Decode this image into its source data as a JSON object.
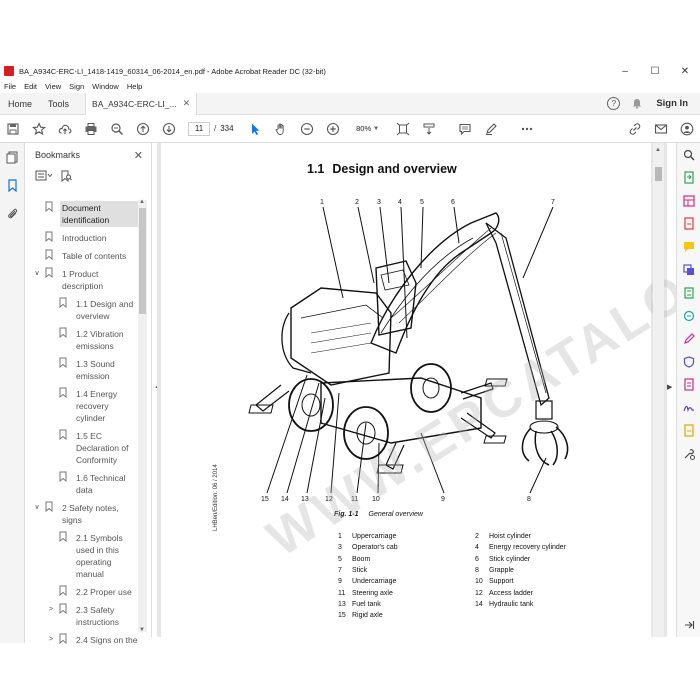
{
  "window": {
    "title": "BA_A934C-ERC-LI_1418-1419_60314_06-2014_en.pdf - Adobe Acrobat Reader DC (32-bit)",
    "controls": [
      "–",
      "☐",
      "✕"
    ]
  },
  "menu": [
    "File",
    "Edit",
    "View",
    "Sign",
    "Window",
    "Help"
  ],
  "tabs": {
    "home": "Home",
    "tools": "Tools",
    "document": "BA_A934C-ERC-LI_...",
    "help_glyph": "?",
    "sign_in": "Sign In"
  },
  "toolbar": {
    "current_page": "11",
    "page_sep": "/",
    "page_count": "334",
    "zoom": "80%"
  },
  "bookmarks": {
    "title": "Bookmarks",
    "close": "✕",
    "items": [
      {
        "label": "Document identification",
        "toggle": "",
        "indent": 0,
        "selected": true
      },
      {
        "label": "Introduction",
        "toggle": "",
        "indent": 0
      },
      {
        "label": "Table of contents",
        "toggle": "",
        "indent": 0
      },
      {
        "label": "1 Product description",
        "toggle": "∨",
        "indent": 0
      },
      {
        "label": "1.1 Design and overview",
        "toggle": "",
        "indent": 1
      },
      {
        "label": "1.2 Vibration emissions",
        "toggle": "",
        "indent": 1
      },
      {
        "label": "1.3 Sound emission",
        "toggle": "",
        "indent": 1
      },
      {
        "label": "1.4 Energy recovery cylinder",
        "toggle": "",
        "indent": 1
      },
      {
        "label": "1.5 EC Declaration of Conformity",
        "toggle": "",
        "indent": 1
      },
      {
        "label": "1.6 Technical data",
        "toggle": "",
        "indent": 1
      },
      {
        "label": "2 Safety notes, signs",
        "toggle": "∨",
        "indent": 0
      },
      {
        "label": "2.1 Symbols used in this operating manual",
        "toggle": "",
        "indent": 1
      },
      {
        "label": "2.2 Proper use",
        "toggle": "",
        "indent": 1
      },
      {
        "label": "2.3 Safety instructions",
        "toggle": ">",
        "indent": 1
      },
      {
        "label": "2.4 Signs on the",
        "toggle": ">",
        "indent": 1
      }
    ]
  },
  "document": {
    "heading_num": "1.1",
    "heading_text": "Design and overview",
    "figure_label": "Fig. 1-1",
    "figure_caption": "General overview",
    "edition": "LHBen/Edition: 06 / 2014",
    "watermark": "WWW.EPCATALOG.COM",
    "callouts_top": [
      "1",
      "2",
      "3",
      "4",
      "5",
      "6",
      "7"
    ],
    "callouts_bottom": [
      "15",
      "14",
      "13",
      "12",
      "11",
      "10",
      "9",
      "8"
    ],
    "legend_left": [
      {
        "num": "1",
        "text": "Uppercarriage"
      },
      {
        "num": "3",
        "text": "Operator's cab"
      },
      {
        "num": "5",
        "text": "Boom"
      },
      {
        "num": "7",
        "text": "Stick"
      },
      {
        "num": "9",
        "text": "Undercarriage"
      },
      {
        "num": "11",
        "text": "Steering axle"
      },
      {
        "num": "13",
        "text": "Fuel tank"
      },
      {
        "num": "15",
        "text": "Rigid axle"
      }
    ],
    "legend_right": [
      {
        "num": "2",
        "text": "Hoist cylinder"
      },
      {
        "num": "4",
        "text": "Energy recovery cylinder"
      },
      {
        "num": "6",
        "text": "Stick cylinder"
      },
      {
        "num": "8",
        "text": "Grapple"
      },
      {
        "num": "10",
        "text": "Support"
      },
      {
        "num": "12",
        "text": "Access ladder"
      },
      {
        "num": "14",
        "text": "Hydraulic tank"
      }
    ]
  },
  "colors": {
    "accent": "#1473e6",
    "pdf_red": "#d31f1f"
  }
}
